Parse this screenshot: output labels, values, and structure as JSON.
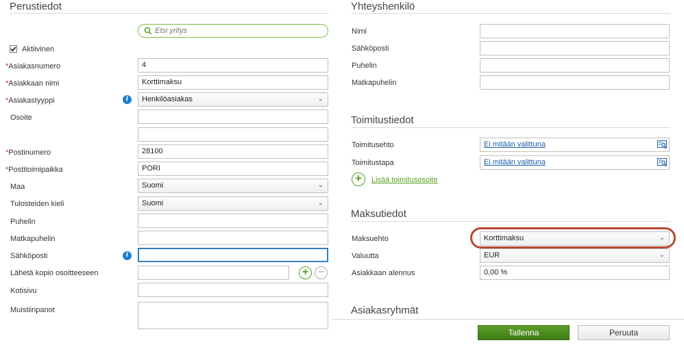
{
  "basic": {
    "title": "Perustiedot",
    "search_placeholder": "Etsi yritys",
    "active_label": "Aktiivinen",
    "customer_number_label": "Asiakasnumero",
    "customer_number_value": "4",
    "customer_name_label": "Asiakkaan nimi",
    "customer_name_value": "Korttimaksu",
    "customer_type_label": "Asiakastyyppi",
    "customer_type_value": "Henkilöasiakas",
    "address_label": "Osoite",
    "address_line1": "",
    "address_line2": "",
    "postal_code_label": "Postinumero",
    "postal_code_value": "28100",
    "city_label": "Postitoimipaikka",
    "city_value": "PORI",
    "country_label": "Maa",
    "country_value": "Suomi",
    "print_language_label": "Tulosteiden kieli",
    "print_language_value": "Suomi",
    "phone_label": "Puhelin",
    "phone_value": "",
    "mobile_label": "Matkapuhelin",
    "mobile_value": "",
    "email_label": "Sähköposti",
    "email_value": "",
    "copy_to_label": "Lähetä kopio osoitteeseen",
    "copy_to_value": "",
    "homepage_label": "Kotisivu",
    "homepage_value": "",
    "notes_label": "Muistiinpanot",
    "notes_value": ""
  },
  "contact": {
    "title": "Yhteyshenkilö",
    "name_label": "Nimi",
    "email_label": "Sähköposti",
    "phone_label": "Puhelin",
    "mobile_label": "Matkapuhelin"
  },
  "delivery": {
    "title": "Toimitustiedot",
    "terms_label": "Toimitusehto",
    "terms_value": "Ei mitään valittuna",
    "method_label": "Toimitustapa",
    "method_value": "Ei mitään valittuna",
    "add_address_label": "Lisää toimitusosoite"
  },
  "payment": {
    "title": "Maksutiedot",
    "terms_label": "Maksuehto",
    "terms_value": "Korttimaksu",
    "currency_label": "Valuutta",
    "currency_value": "EUR",
    "discount_label": "Asiakkaan alennus",
    "discount_value": "0,00 %",
    "highlight_color": "#b5482f"
  },
  "groups": {
    "title": "Asiakasryhmät"
  },
  "footer": {
    "save_label": "Tallenna",
    "cancel_label": "Peruuta"
  },
  "icons": {
    "info": "info-icon",
    "search": "search-icon",
    "lookup": "lookup-icon",
    "add": "add-icon",
    "remove": "remove-icon",
    "chevron": "chevron-down-icon",
    "checkbox": "checkbox-checked-icon"
  },
  "colors": {
    "accent_green": "#5a9e22",
    "save_button": "#4a8a1e",
    "link_blue": "#1a5fa8",
    "info_blue": "#1a7fd4",
    "focus_blue": "#2f7fc1"
  }
}
